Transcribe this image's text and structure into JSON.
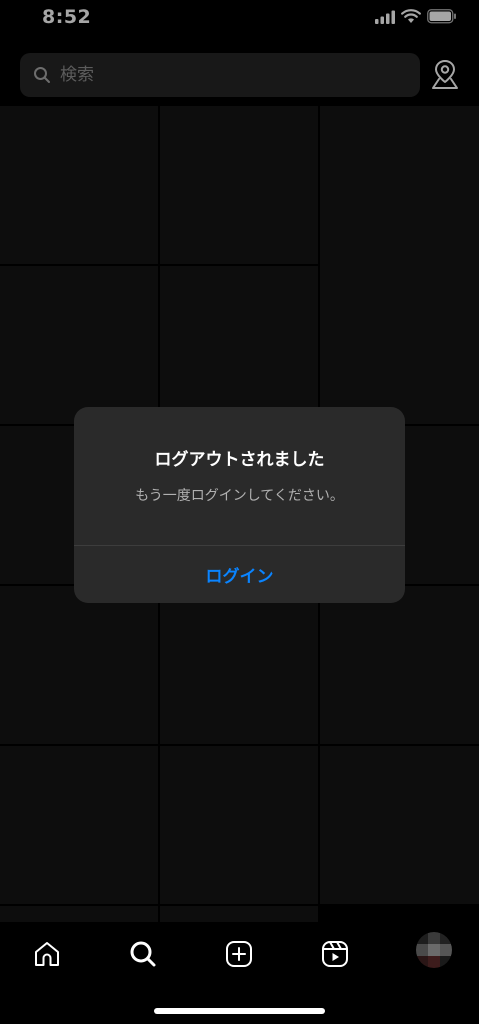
{
  "status_bar": {
    "time": "8:52",
    "signal_icon": "signal-bars-icon",
    "wifi_icon": "wifi-icon",
    "battery_icon": "battery-icon"
  },
  "search": {
    "placeholder": "検索",
    "icon": "search-icon"
  },
  "map_button": {
    "icon": "map-pin-icon"
  },
  "grid": {
    "cell_count": 15
  },
  "alert": {
    "title": "ログアウトされました",
    "message": "もう一度ログインしてください。",
    "button_label": "ログイン"
  },
  "tab_bar": {
    "items": [
      {
        "icon": "home-icon"
      },
      {
        "icon": "search-icon"
      },
      {
        "icon": "create-post-icon"
      },
      {
        "icon": "reels-icon"
      },
      {
        "icon": "profile-avatar"
      }
    ]
  },
  "colors": {
    "background": "#000000",
    "alert_background": "#2a2a2a",
    "accent": "#0a84ff",
    "search_background": "#262626"
  }
}
